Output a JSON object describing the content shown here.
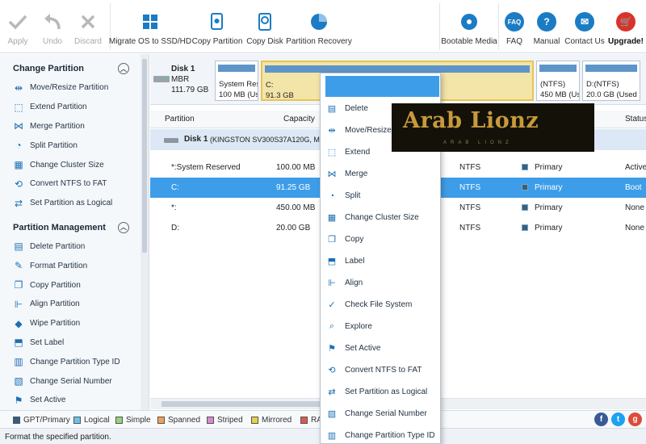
{
  "toolbar": {
    "apply": "Apply",
    "undo": "Undo",
    "discard": "Discard",
    "migrate": "Migrate OS to SSD/HD",
    "copy_partition": "Copy Partition",
    "copy_disk": "Copy Disk",
    "partition_recovery": "Partition Recovery",
    "bootable_media": "Bootable Media",
    "faq": "FAQ",
    "manual": "Manual",
    "contact": "Contact Us",
    "upgrade": "Upgrade!"
  },
  "sidebar": {
    "change_partition": {
      "title": "Change Partition",
      "items": [
        {
          "label": "Move/Resize Partition",
          "icon": "resize-icon"
        },
        {
          "label": "Extend Partition",
          "icon": "extend-icon"
        },
        {
          "label": "Merge Partition",
          "icon": "merge-icon"
        },
        {
          "label": "Split Partition",
          "icon": "split-icon"
        },
        {
          "label": "Change Cluster Size",
          "icon": "cluster-icon"
        },
        {
          "label": "Convert NTFS to FAT",
          "icon": "convert-icon"
        },
        {
          "label": "Set Partition as Logical",
          "icon": "logical-icon"
        }
      ]
    },
    "partition_management": {
      "title": "Partition Management",
      "items": [
        {
          "label": "Delete Partition",
          "icon": "delete-icon"
        },
        {
          "label": "Format Partition",
          "icon": "format-icon"
        },
        {
          "label": "Copy Partition",
          "icon": "copy-icon"
        },
        {
          "label": "Align Partition",
          "icon": "align-icon"
        },
        {
          "label": "Wipe Partition",
          "icon": "wipe-icon"
        },
        {
          "label": "Set Label",
          "icon": "label-icon"
        },
        {
          "label": "Change Partition Type ID",
          "icon": "type-id-icon"
        },
        {
          "label": "Change Serial Number",
          "icon": "serial-icon"
        },
        {
          "label": "Set Active",
          "icon": "flag-icon"
        }
      ]
    }
  },
  "diskmap": {
    "disk_name": "Disk 1",
    "disk_type": "MBR",
    "disk_size": "111.79 GB",
    "blocks": [
      {
        "name": "System Rese",
        "info": "100 MB (Use"
      },
      {
        "name": "C:",
        "info": "91.3 GB"
      },
      {
        "name": "(NTFS)",
        "info": "450 MB (Use"
      },
      {
        "name": "D:(NTFS)",
        "info": "20.0 GB (Used"
      }
    ]
  },
  "table": {
    "headers": {
      "partition": "Partition",
      "capacity": "Capacity",
      "status": "Status"
    },
    "disk_row": {
      "name": "Disk 1",
      "detail": "(KINGSTON SV300S37A120G, MBR"
    },
    "rows": [
      {
        "partition": "*:System Reserved",
        "capacity": "100.00 MB",
        "fs": "NTFS",
        "type": "Primary",
        "status": "Active"
      },
      {
        "partition": "C:",
        "capacity": "91.25 GB",
        "fs": "NTFS",
        "type": "Primary",
        "status": "Boot"
      },
      {
        "partition": "*:",
        "capacity": "450.00 MB",
        "fs": "NTFS",
        "type": "Primary",
        "status": "None"
      },
      {
        "partition": "D:",
        "capacity": "20.00 GB",
        "fs": "NTFS",
        "type": "Primary",
        "status": "None"
      }
    ]
  },
  "context_menu": [
    {
      "label": "Delete",
      "icon": "delete-icon"
    },
    {
      "label": "Move/Resize",
      "icon": "resize-icon"
    },
    {
      "label": "Extend",
      "icon": "extend-icon"
    },
    {
      "label": "Merge",
      "icon": "merge-icon"
    },
    {
      "label": "Split",
      "icon": "split-icon"
    },
    {
      "label": "Change Cluster Size",
      "icon": "cluster-icon"
    },
    {
      "label": "Copy",
      "icon": "copy-icon"
    },
    {
      "label": "Label",
      "icon": "label-icon"
    },
    {
      "label": "Align",
      "icon": "align-icon"
    },
    {
      "label": "Check File System",
      "icon": "check-icon"
    },
    {
      "label": "Explore",
      "icon": "search-icon"
    },
    {
      "label": "Set Active",
      "icon": "flag-icon"
    },
    {
      "label": "Convert NTFS to FAT",
      "icon": "convert-icon"
    },
    {
      "label": "Set Partition as Logical",
      "icon": "logical-icon"
    },
    {
      "label": "Change Serial Number",
      "icon": "serial-icon"
    },
    {
      "label": "Change Partition Type ID",
      "icon": "type-id-icon"
    }
  ],
  "legend": [
    {
      "label": "GPT/Primary",
      "color": "#2f5f86"
    },
    {
      "label": "Logical",
      "color": "#6cc2e8"
    },
    {
      "label": "Simple",
      "color": "#9ad07a"
    },
    {
      "label": "Spanned",
      "color": "#f0a05a"
    },
    {
      "label": "Striped",
      "color": "#d78ad0"
    },
    {
      "label": "Mirrored",
      "color": "#e6d24a"
    },
    {
      "label": "RAI",
      "color": "#e0574f"
    }
  ],
  "social": {
    "facebook": "f",
    "twitter": "t",
    "google": "g"
  },
  "status_bar": "Format the specified partition.",
  "watermark": {
    "title": "Arab Lionz",
    "subtitle": "ARAB LIONZ"
  },
  "colors": {
    "accent": "#3d9de8",
    "selected_block": "#f3e4a8"
  }
}
